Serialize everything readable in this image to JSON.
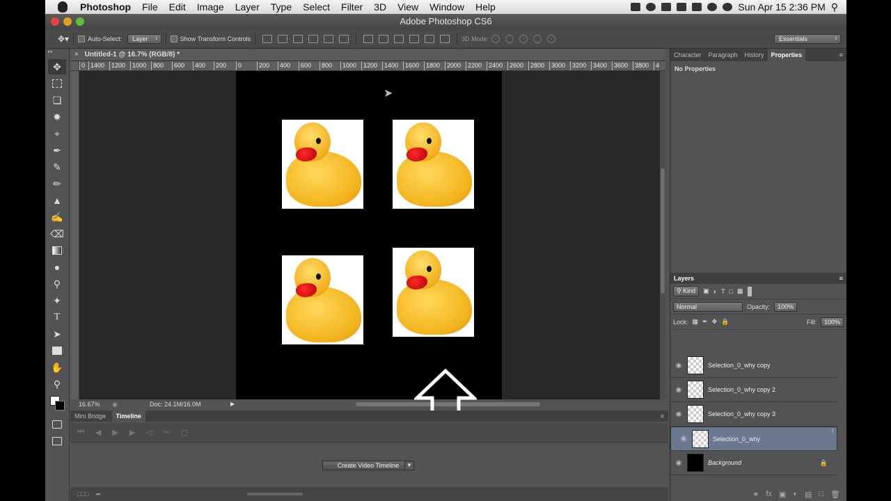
{
  "menubar": {
    "app": "Photoshop",
    "items": [
      "File",
      "Edit",
      "Image",
      "Layer",
      "Type",
      "Select",
      "Filter",
      "3D",
      "View",
      "Window",
      "Help"
    ],
    "clock": "Sun Apr 15  2:36 PM"
  },
  "window": {
    "title": "Adobe Photoshop CS6"
  },
  "options": {
    "auto_select_label": "Auto-Select:",
    "auto_select_value": "Layer",
    "transform_controls_label": "Show Transform Controls",
    "mode_3d_label": "3D Mode:",
    "workspace": "Essentials"
  },
  "document": {
    "tab_title": "Untitled-1 @ 16.7% (RGB/8) *",
    "ruler_ticks": [
      "0",
      "1400",
      "1200",
      "1000",
      "800",
      "600",
      "400",
      "200",
      "0",
      "200",
      "400",
      "600",
      "800",
      "1000",
      "1200",
      "1400",
      "1600",
      "1800",
      "2000",
      "2200",
      "2400",
      "2600",
      "2800",
      "3000",
      "3200",
      "3400",
      "3600",
      "3800",
      "4"
    ],
    "zoom": "16.67%",
    "doc_size": "Doc: 24.1M/16.0M"
  },
  "timeline": {
    "tabs": [
      "Mini Bridge",
      "Timeline"
    ],
    "create_button": "Create Video Timeline"
  },
  "panels": {
    "top_tabs": [
      "Character",
      "Paragraph",
      "History",
      "Properties"
    ],
    "properties_text": "No Properties",
    "layers_tab": "Layers",
    "filter_kind": "Kind",
    "blend_mode": "Normal",
    "opacity_label": "Opacity:",
    "opacity_value": "100%",
    "lock_label": "Lock:",
    "fill_label": "Fill:",
    "fill_value": "100%"
  },
  "layers": [
    {
      "name": "Selection_0_why copy",
      "selected": false
    },
    {
      "name": "Selection_0_why copy 2",
      "selected": false
    },
    {
      "name": "Selection_0_why copy 3",
      "selected": false
    },
    {
      "name": "Selection_0_why",
      "selected": true
    },
    {
      "name": "Background",
      "selected": false
    }
  ],
  "colors": {
    "accent_selected": "#6b7990",
    "canvas": "#000000",
    "workspace_bg": "#282828"
  }
}
